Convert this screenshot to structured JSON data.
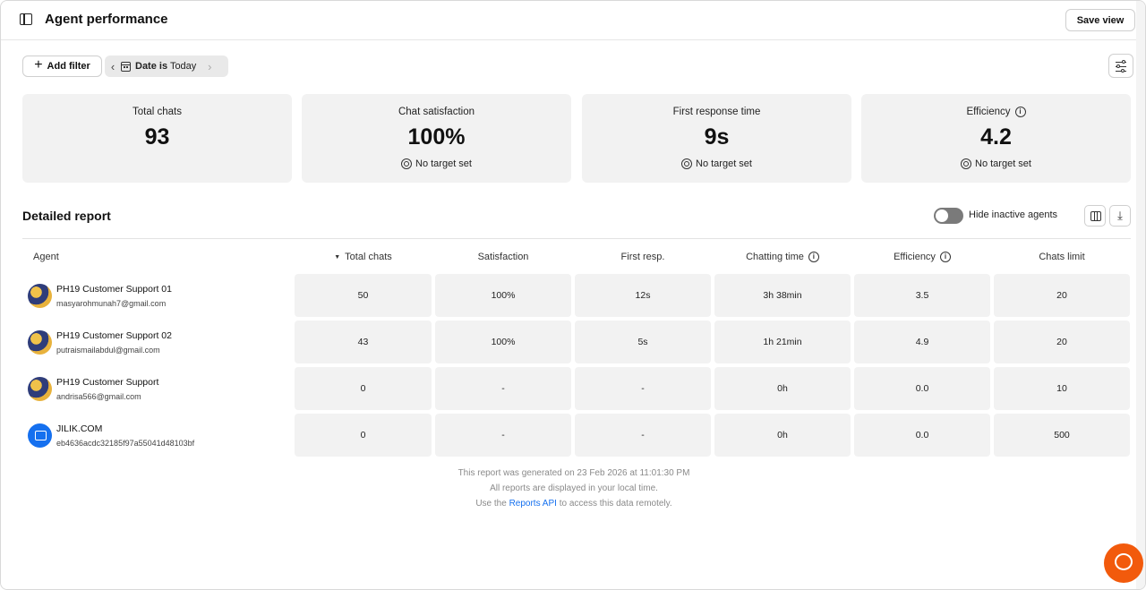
{
  "header": {
    "title": "Agent performance",
    "save_view": "Save view"
  },
  "filters": {
    "add_filter": "Add filter",
    "date_bold": "Date is",
    "date_value": "Today"
  },
  "stats": [
    {
      "label": "Total chats",
      "value": "93",
      "target": ""
    },
    {
      "label": "Chat satisfaction",
      "value": "100%",
      "target": "No target set"
    },
    {
      "label": "First response time",
      "value": "9s",
      "target": "No target set"
    },
    {
      "label": "Efficiency",
      "value": "4.2",
      "target": "No target set"
    }
  ],
  "report": {
    "title": "Detailed report",
    "toggle_label": "Hide inactive agents",
    "columns": [
      "Agent",
      "Total chats",
      "Satisfaction",
      "First resp.",
      "Chatting time",
      "Efficiency",
      "Chats limit"
    ],
    "rows": [
      {
        "name": "PH19 Customer Support 01",
        "email": "masyarohmunah7@gmail.com",
        "total_chats": "50",
        "satisfaction": "100%",
        "first_resp": "12s",
        "chatting_time": "3h 38min",
        "efficiency": "3.5",
        "chats_limit": "20"
      },
      {
        "name": "PH19 Customer Support 02",
        "email": "putraismailabdul@gmail.com",
        "total_chats": "43",
        "satisfaction": "100%",
        "first_resp": "5s",
        "chatting_time": "1h 21min",
        "efficiency": "4.9",
        "chats_limit": "20"
      },
      {
        "name": "PH19 Customer Support",
        "email": "andrisa566@gmail.com",
        "total_chats": "0",
        "satisfaction": "-",
        "first_resp": "-",
        "chatting_time": "0h",
        "efficiency": "0.0",
        "chats_limit": "10"
      },
      {
        "name": "JILIK.COM",
        "email": "eb4636acdc32185f97a55041d48103bf",
        "total_chats": "0",
        "satisfaction": "-",
        "first_resp": "-",
        "chatting_time": "0h",
        "efficiency": "0.0",
        "chats_limit": "500"
      }
    ]
  },
  "footer": {
    "generated": "This report was generated on 23 Feb 2026 at 11:01:30 PM",
    "local_time": "All reports are displayed in your local time.",
    "api_prefix": "Use the",
    "api_link": "Reports API",
    "api_suffix": "to access this data remotely."
  }
}
